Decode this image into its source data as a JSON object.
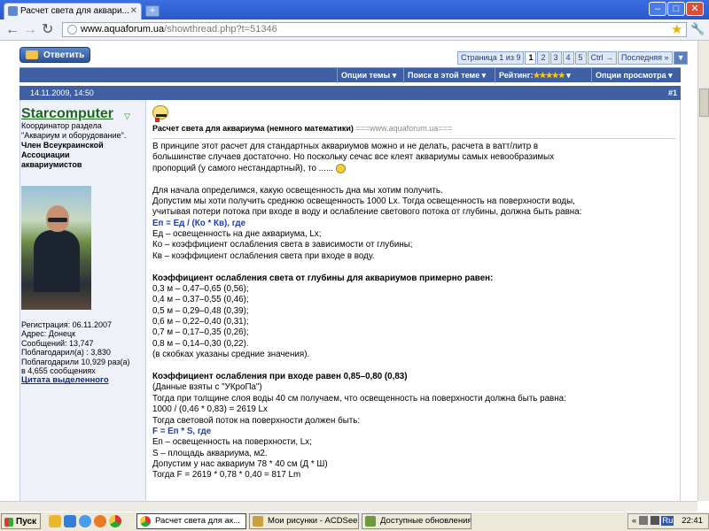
{
  "browser": {
    "tab_title": "Расчет света для аквари...",
    "new_tab": "+",
    "url_domain": "www.aquaforum.ua",
    "url_path": "/showthread.php?t=51346",
    "min": "–",
    "max": "□",
    "close": "✕"
  },
  "thread": {
    "reply_label": "Ответить",
    "pager": {
      "label": "Страница 1 из 9",
      "pages": [
        "1",
        "2",
        "3",
        "4",
        "5"
      ],
      "next": "Ctrl →",
      "last": "Последняя »"
    },
    "options": {
      "thread_options": "Опции темы",
      "search": "Поиск в этой теме",
      "rating_label": "Рейтинг:",
      "rating_stars": "★★★★★",
      "view_options": "Опции просмотра"
    }
  },
  "post": {
    "date": "14.11.2009, 14:50",
    "number": "#1",
    "user": {
      "name": "Starcomputer",
      "title_lines": [
        "Координатор раздела",
        "\"Аквариум и оборудование\".",
        "Член Всеукраинской",
        "Ассоциации",
        "аквариумистов"
      ],
      "info_lines": [
        "Регистрация: 06.11.2007",
        "Адрес: Донецк",
        "Сообщений: 13,747",
        "Поблагодарил(а) : 3,830",
        "Поблагодарили 10,929 раз(а)",
        "в 4,655 сообщениях"
      ],
      "quote_link": "Цитата выделенного"
    },
    "title": "Расчет света для аквариума (немного математики)",
    "title_url": "===www.aquaforum.ua===",
    "lines": [
      {
        "t": "В принципе этот расчет для стандартных аквариумов можно и не делать, расчета в ватт/литр в",
        "s": ""
      },
      {
        "t": "большинстве случаев достаточно. Но поскольку сечас все клеят аквариумы самых невообразимых",
        "s": ""
      },
      {
        "t": "пропорций (у самого нестандартный), то ......",
        "s": "",
        "smile": true
      },
      {
        "t": "",
        "s": ""
      },
      {
        "t": "Для начала определимся, какую освещенность дна мы хотим получить.",
        "s": ""
      },
      {
        "t": "Допустим мы хоти получить среднюю освещенность 1000 Lx. Тогда освещенность на поверхности воды,",
        "s": ""
      },
      {
        "t": "учитывая потери потока при входе в воду и ослабление светового потока от глубины, должна быть равна:",
        "s": ""
      },
      {
        "t": "Еп = Ед / (Ко * Кв), где",
        "s": "blue"
      },
      {
        "t": "Ед – освещенность на дне аквариума, Lx;",
        "s": ""
      },
      {
        "t": "Ко – коэффициент ослабления света в зависимости от глубины;",
        "s": ""
      },
      {
        "t": "Кв – коэффициент ослабления света при входе в воду.",
        "s": ""
      },
      {
        "t": "",
        "s": ""
      },
      {
        "t": "Коэффициент ослабления света от глубины для аквариумов примерно равен:",
        "s": "b"
      },
      {
        "t": "0,3 м – 0,47–0,65 (0,56);",
        "s": ""
      },
      {
        "t": "0,4 м – 0,37–0,55 (0,46);",
        "s": ""
      },
      {
        "t": "0,5 м – 0,29–0,48 (0,39);",
        "s": ""
      },
      {
        "t": "0,6 м – 0,22–0,40 (0,31);",
        "s": ""
      },
      {
        "t": "0,7 м – 0,17–0,35 (0,26);",
        "s": ""
      },
      {
        "t": "0,8 м – 0,14–0,30 (0,22).",
        "s": ""
      },
      {
        "t": "(в скобках указаны средние значения).",
        "s": ""
      },
      {
        "t": "",
        "s": ""
      },
      {
        "t": "Коэффициент ослабления при входе равен 0,85–0,80 (0,83)",
        "s": "b"
      },
      {
        "t": "(Данные взяты с \"УКроПа\")",
        "s": ""
      },
      {
        "t": "Тогда при толщине слоя воды 40 см получаем, что освещенность на поверхности должна быть равна:",
        "s": ""
      },
      {
        "t": "1000 / (0,46 * 0,83) = 2619 Lx",
        "s": ""
      },
      {
        "t": "Тогда световой поток на поверхности должен быть:",
        "s": ""
      },
      {
        "t": "F = Еп * S, где",
        "s": "blue"
      },
      {
        "t": "Еп – освещенность на поверхности, Lx;",
        "s": ""
      },
      {
        "t": "S – площадь аквариума, м2.",
        "s": ""
      },
      {
        "t": "Допустим у нас аквариум 78 * 40 см (Д * Ш)",
        "s": ""
      },
      {
        "t": "Тогда F = 2619 * 0,78 * 0,40 = 817 Lm",
        "s": ""
      }
    ]
  },
  "taskbar": {
    "start": "Пуск",
    "tasks": [
      {
        "label": "Расчет света для ак...",
        "active": true
      },
      {
        "label": "Мои рисунки - ACDSee ...",
        "active": false
      },
      {
        "label": "Доступные обновления",
        "active": false
      }
    ],
    "tray_lang": "Ru",
    "clock": "22:41"
  },
  "colors": {
    "forum_bar": "#3e5fa2",
    "username_green": "#1c6a1c",
    "formula_blue": "#1f3fa8"
  }
}
